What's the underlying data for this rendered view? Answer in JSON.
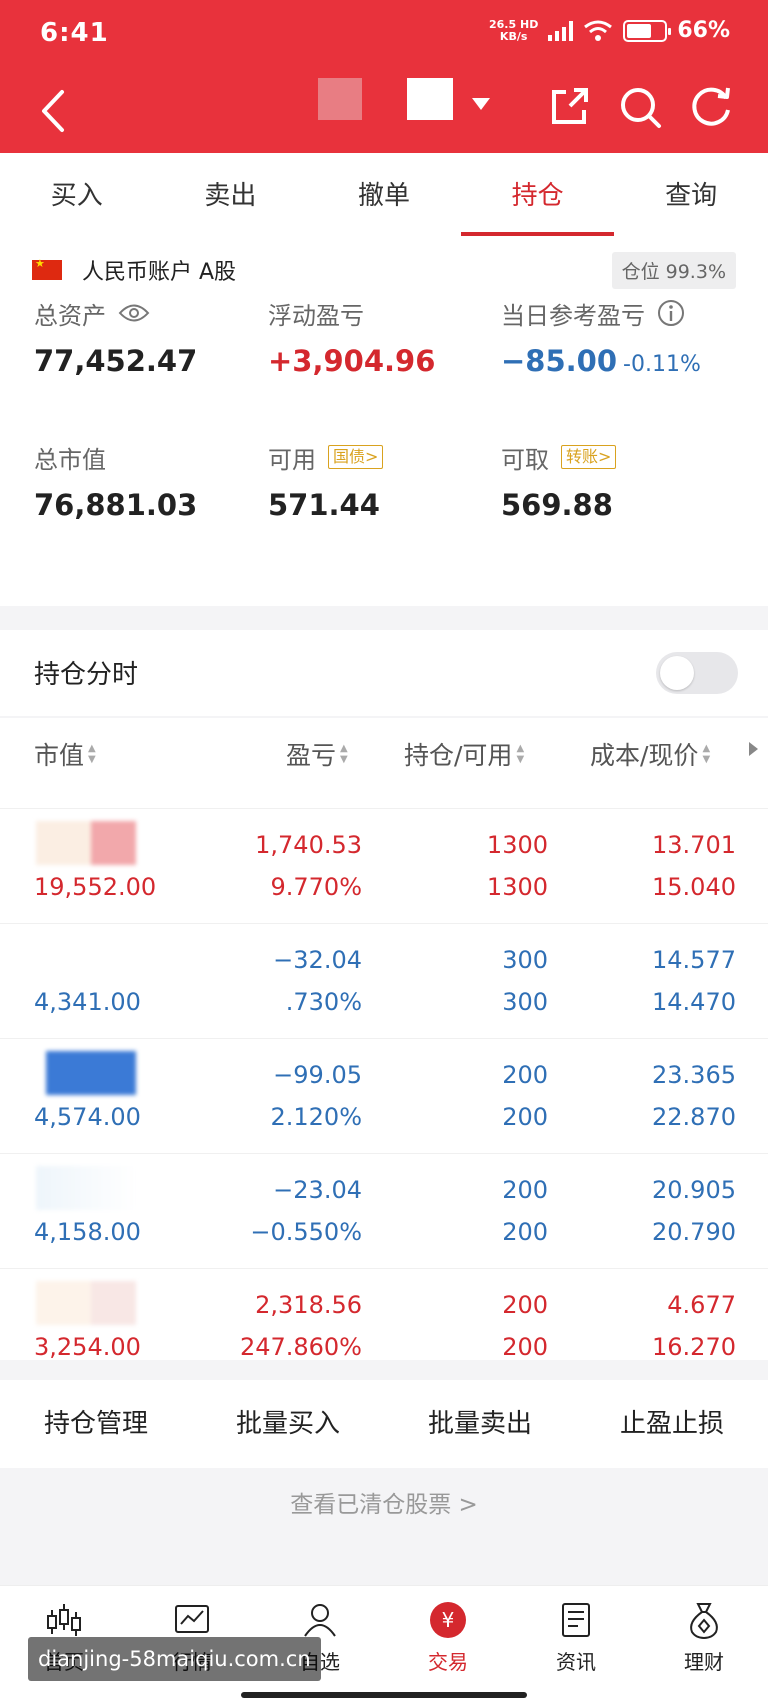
{
  "status": {
    "time": "6:41",
    "net_speed": "26.5",
    "net_unit": "KB/s",
    "hd": "HD",
    "battery": "66%",
    "battery_level": 0.66
  },
  "colors": {
    "brand": "#e8323c",
    "up": "#d4282e",
    "down": "#2f6fb5",
    "badge": "#d9a21f"
  },
  "tabs": [
    "买入",
    "卖出",
    "撤单",
    "持仓",
    "查询"
  ],
  "active_tab": "持仓",
  "account": {
    "label": "人民币账户 A股",
    "position_ratio": "仓位 99.3%",
    "total_assets_label": "总资产",
    "total_assets": "77,452.47",
    "float_pl_label": "浮动盈亏",
    "float_pl": "+3,904.96",
    "daily_pl_label": "当日参考盈亏",
    "daily_pl": "−85.00",
    "daily_pl_pct": "-0.11%",
    "market_value_label": "总市值",
    "market_value": "76,881.03",
    "available_label": "可用",
    "available_tag": "国债>",
    "available": "571.44",
    "withdrawable_label": "可取",
    "withdrawable_tag": "转账>",
    "withdrawable": "569.88"
  },
  "intraday": {
    "label": "持仓分时",
    "enabled": false
  },
  "table": {
    "headers": [
      "市值",
      "盈亏",
      "持仓/可用",
      "成本/现价"
    ],
    "rows": [
      {
        "market_value": "19,552.00",
        "pl": "1,740.53",
        "pl_pct": "9.770%",
        "holding": "1300",
        "available": "1300",
        "cost": "13.701",
        "price": "15.040",
        "trend": "up"
      },
      {
        "market_value": "4,341.00",
        "pl": "−32.04",
        "pl_pct": ".730%",
        "holding": "300",
        "available": "300",
        "cost": "14.577",
        "price": "14.470",
        "trend": "down"
      },
      {
        "market_value": "4,574.00",
        "pl": "−99.05",
        "pl_pct": "2.120%",
        "holding": "200",
        "available": "200",
        "cost": "23.365",
        "price": "22.870",
        "trend": "down"
      },
      {
        "market_value": "4,158.00",
        "pl": "−23.04",
        "pl_pct": "−0.550%",
        "holding": "200",
        "available": "200",
        "cost": "20.905",
        "price": "20.790",
        "trend": "down"
      },
      {
        "market_value": "3,254.00",
        "pl": "2,318.56",
        "pl_pct": "247.860%",
        "holding": "200",
        "available": "200",
        "cost": "4.677",
        "price": "16.270",
        "trend": "up"
      }
    ]
  },
  "actions": [
    "持仓管理",
    "批量买入",
    "批量卖出",
    "止盈止损"
  ],
  "cleared_link": "查看已清仓股票 >",
  "bottom_nav": [
    {
      "label": "首页",
      "icon": "candlestick-icon"
    },
    {
      "label": "行情",
      "icon": "chart-icon"
    },
    {
      "label": "自选",
      "icon": "user-icon"
    },
    {
      "label": "交易",
      "icon": "yen-icon"
    },
    {
      "label": "资讯",
      "icon": "document-icon"
    },
    {
      "label": "理财",
      "icon": "money-bag-icon"
    }
  ],
  "watermark": "dianjing-58maiqiu.com.cn"
}
